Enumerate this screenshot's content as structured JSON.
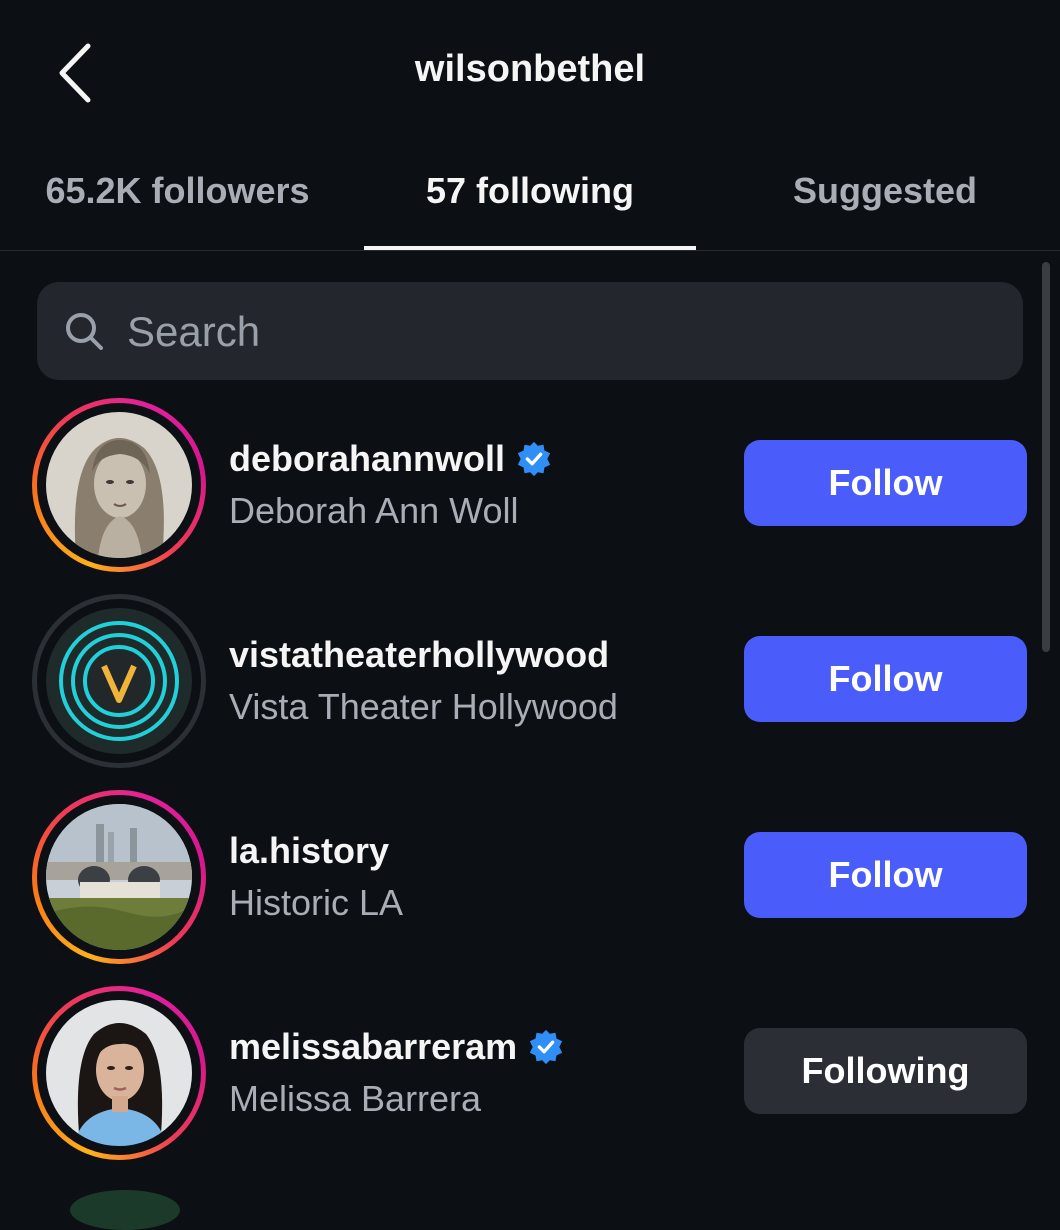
{
  "header": {
    "title": "wilsonbethel"
  },
  "tabs": [
    {
      "label": "65.2K followers",
      "active": false
    },
    {
      "label": "57 following",
      "active": true
    },
    {
      "label": "Suggested",
      "active": false
    }
  ],
  "search": {
    "placeholder": "Search",
    "value": ""
  },
  "accounts": [
    {
      "username": "deborahannwoll",
      "full_name": "Deborah Ann Woll",
      "verified": true,
      "story_ring": true,
      "button": "Follow"
    },
    {
      "username": "vistatheaterhollywood",
      "full_name": "Vista Theater Hollywood",
      "verified": false,
      "story_ring": false,
      "button": "Follow"
    },
    {
      "username": "la.history",
      "full_name": "Historic LA",
      "verified": false,
      "story_ring": true,
      "button": "Follow"
    },
    {
      "username": "melissabarreram",
      "full_name": "Melissa Barrera",
      "verified": true,
      "story_ring": true,
      "button": "Following"
    }
  ],
  "colors": {
    "background": "#0c0f14",
    "follow_button": "#4a5dfb",
    "following_button": "#2b2e35",
    "verified_badge": "#2f8ff7"
  },
  "icons": [
    "back-chevron-icon",
    "search-icon",
    "verified-badge-icon"
  ]
}
